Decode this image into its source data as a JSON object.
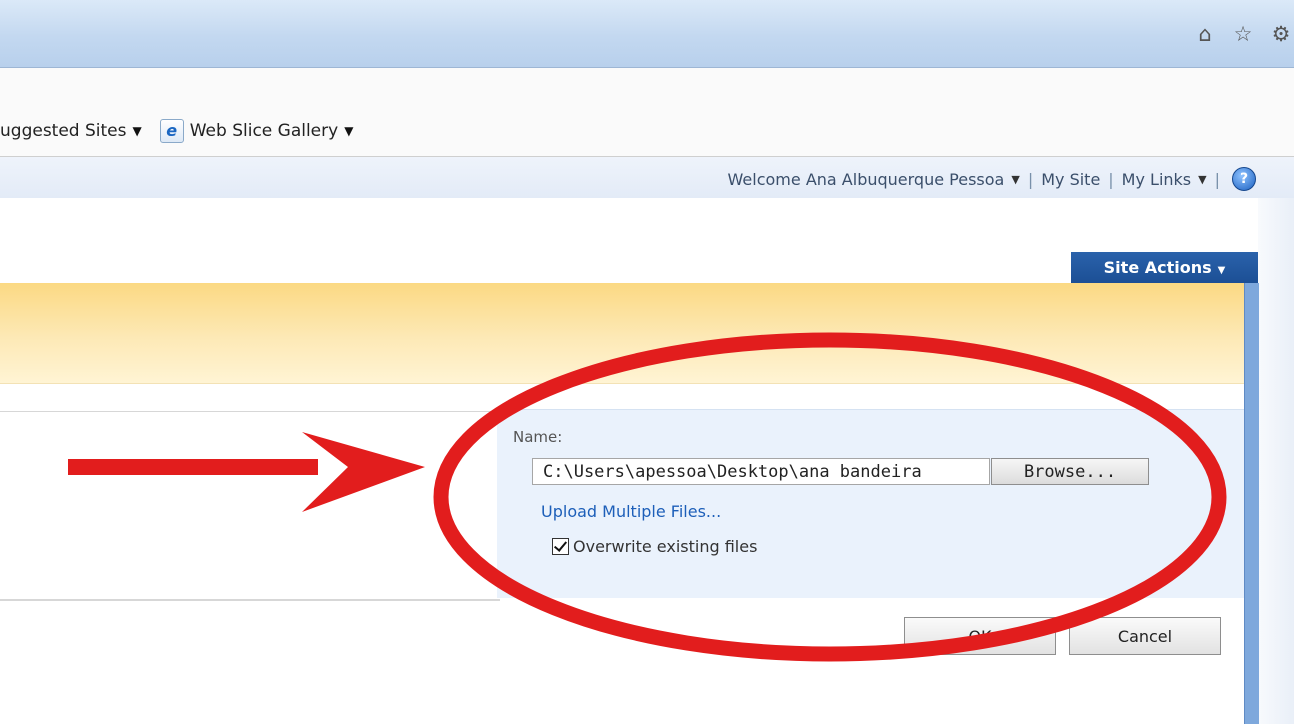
{
  "favorites_bar": {
    "suggested_sites": "uggested Sites",
    "web_slice_gallery": "Web Slice Gallery"
  },
  "welcome_bar": {
    "welcome": "Welcome Ana Albuquerque Pessoa",
    "my_site": "My Site",
    "my_links": "My Links",
    "separator": "|"
  },
  "site_actions": {
    "label": "Site Actions"
  },
  "upload_form": {
    "name_label": "Name:",
    "file_path": "C:\\Users\\apessoa\\Desktop\\ana bandeira",
    "browse_label": "Browse...",
    "upload_multiple_label": "Upload Multiple Files...",
    "overwrite_label": "Overwrite existing files",
    "overwrite_checked": true,
    "ok_label": "OK",
    "cancel_label": "Cancel"
  },
  "colors": {
    "annotation": "#e21d1d",
    "site_actions": "#1f559e",
    "link": "#1d5fb9",
    "banner": "#fbd983"
  },
  "icons": {
    "chrome": [
      "home-icon",
      "star-icon",
      "gear-icon"
    ],
    "favorites": [
      "ie-icon"
    ],
    "welcome": [
      "help-icon"
    ]
  }
}
